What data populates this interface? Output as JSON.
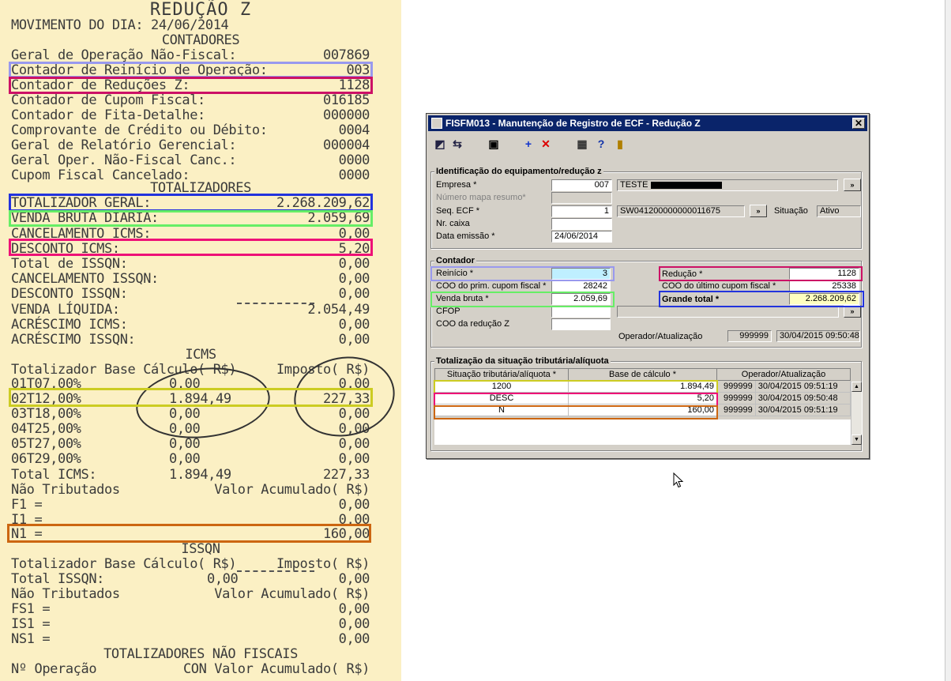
{
  "receipt": {
    "title": "REDUÇÃO Z",
    "movimento": "MOVIMENTO DO DIA: 24/06/2014",
    "contadores_header": "CONTADORES",
    "contadores": [
      {
        "label": "Geral de Operação Não-Fiscal:",
        "value": "007869"
      },
      {
        "label": "Contador de Reinício de Operação:",
        "value": "003"
      },
      {
        "label": "Contador de Reduções Z:",
        "value": "1128"
      },
      {
        "label": "Contador de Cupom Fiscal:",
        "value": "016185"
      },
      {
        "label": "Contador de Fita-Detalhe:",
        "value": "000000"
      },
      {
        "label": "Comprovante de Crédito ou Débito:",
        "value": "0004"
      },
      {
        "label": "Geral de Relatório Gerencial:",
        "value": "000004"
      },
      {
        "label": "Geral Oper. Não-Fiscal Canc.:",
        "value": "0000"
      },
      {
        "label": "Cupom Fiscal Cancelado:",
        "value": "0000"
      }
    ],
    "totalizadores_header": "TOTALIZADORES",
    "totalizadores": [
      {
        "label": "TOTALIZADOR GERAL:",
        "value": "2.268.209,62"
      },
      {
        "label": "VENDA BRUTA DIÁRIA:",
        "value": "2.059,69"
      },
      {
        "label": "CANCELAMENTO ICMS:",
        "value": "0,00"
      },
      {
        "label": "DESCONTO ICMS:",
        "value": "5,20"
      },
      {
        "label": "Total de ISSQN:",
        "value": "0,00"
      },
      {
        "label": "CANCELAMENTO ISSQN:",
        "value": "0,00"
      },
      {
        "label": "DESCONTO ISSQN:",
        "value": "0,00"
      },
      {
        "label": "VENDA LÍQUIDA:",
        "value": "2.054,49"
      },
      {
        "label": "ACRÉSCIMO ICMS:",
        "value": "0,00"
      },
      {
        "label": "ACRÉSCIMO ISSQN:",
        "value": "0,00"
      }
    ],
    "icms_header": "ICMS",
    "icms_col_left": "Totalizador Base Cálculo( R$)",
    "icms_col_right": "Imposto( R$)",
    "icms_rows": [
      {
        "label": "01T07,00%",
        "base": "0,00",
        "imposto": "0,00"
      },
      {
        "label": "02T12,00%",
        "base": "1.894,49",
        "imposto": "227,33"
      },
      {
        "label": "03T18,00%",
        "base": "0,00",
        "imposto": "0,00"
      },
      {
        "label": "04T25,00%",
        "base": "0,00",
        "imposto": "0,00"
      },
      {
        "label": "05T27,00%",
        "base": "0,00",
        "imposto": "0,00"
      },
      {
        "label": "06T29,00%",
        "base": "0,00",
        "imposto": "0,00"
      },
      {
        "label": "Total ICMS:",
        "base": "1.894,49",
        "imposto": "227,33"
      }
    ],
    "nao_trib_left": "Não Tributados",
    "nao_trib_right": "Valor Acumulado( R$)",
    "nao_trib_rows": [
      {
        "label": "F1 =",
        "value": "0,00"
      },
      {
        "label": "I1 =",
        "value": "0,00"
      },
      {
        "label": "N1 =",
        "value": "160,00"
      }
    ],
    "issqn_header": "ISSQN",
    "issqn_col_left": "Totalizador Base Cálculo( R$)",
    "issqn_col_right": "Imposto( R$)",
    "issqn_total": {
      "label": "Total ISSQN:",
      "base": "0,00",
      "imposto": "0,00"
    },
    "issqn_nao_trib_left": "Não Tributados",
    "issqn_nao_trib_right": "Valor Acumulado( R$)",
    "issqn_nao_trib_rows": [
      {
        "label": "FS1 =",
        "value": "0,00"
      },
      {
        "label": "IS1 =",
        "value": "0,00"
      },
      {
        "label": "NS1 =",
        "value": "0,00"
      }
    ],
    "nao_fiscais_header": "TOTALIZADORES NÃO FISCAIS",
    "nao_fiscais_left": "Nº Operação",
    "nao_fiscais_right": "CON Valor Acumulado( R$)",
    "highlight_colors": {
      "reinicio": "#9999ee",
      "reducao": "#cc1166",
      "grande_total": "#2233dd",
      "venda_bruta": "#66ee66",
      "desconto": "#ee1177",
      "aliquota": "#cccc22",
      "n1": "#cc6611"
    }
  },
  "dialog": {
    "title": "FISFM013 - Manutenção de Registro de ECF - Redução Z",
    "close_label": "✕",
    "toolbar": {
      "icons": [
        "first-record-icon",
        "swap-icon",
        "save-icon",
        "add-icon",
        "delete-icon",
        "calendar-icon",
        "help-icon",
        "exit-icon"
      ],
      "add_glyph": "+",
      "delete_glyph": "✕",
      "help_glyph": "?"
    },
    "ident": {
      "group_title": "Identificação do equipamento/redução z",
      "empresa_label": "Empresa *",
      "empresa_value": "007",
      "empresa_name": "TESTE",
      "numero_mapa_label": "Número mapa resumo*",
      "seq_ecf_label": "Seq. ECF *",
      "seq_ecf_value": "1",
      "seq_ecf_serial": "SW041200000000011675",
      "situacao_label": "Situação",
      "situacao_value": "Ativo",
      "nr_caixa_label": "Nr. caixa",
      "data_emissao_label": "Data emissão *",
      "data_emissao_value": "24/06/2014",
      "lookup_glyph": "»"
    },
    "contador": {
      "group_title": "Contador",
      "reinicio_label": "Reinício *",
      "reinicio_value": "3",
      "reducao_label": "Redução *",
      "reducao_value": "1128",
      "coo_prim_label": "COO do prim. cupom fiscal *",
      "coo_prim_value": "28242",
      "coo_ult_label": "COO do último cupom fiscal *",
      "coo_ult_value": "25338",
      "venda_bruta_label": "Venda bruta *",
      "venda_bruta_value": "2.059,69",
      "grande_total_label": "Grande total *",
      "grande_total_value": "2.268.209,62",
      "cfop_label": "CFOP",
      "coo_reducao_label": "COO da redução Z",
      "operador_label": "Operador/Atualização",
      "operador_value": "999999",
      "atualizacao_value": "30/04/2015 09:50:48"
    },
    "totalizacao": {
      "group_title": "Totalização da situação tributária/alíquota",
      "columns": [
        "Situação tributária/alíquota *",
        "Base de cálculo *",
        "Operador/Atualização"
      ],
      "rows": [
        {
          "situacao": "1200",
          "base": "1.894,49",
          "operador": "999999",
          "data": "30/04/2015 09:51:19"
        },
        {
          "situacao": "DESC",
          "base": "5,20",
          "operador": "999999",
          "data": "30/04/2015 09:50:48"
        },
        {
          "situacao": "N",
          "base": "160,00",
          "operador": "999999",
          "data": "30/04/2015 09:51:19"
        }
      ]
    },
    "colors": {
      "titlebar": "#0a246a",
      "face": "#d4d0c8",
      "reinicio_field": "#bfefff",
      "grande_total_field": "#ffffc0"
    }
  }
}
